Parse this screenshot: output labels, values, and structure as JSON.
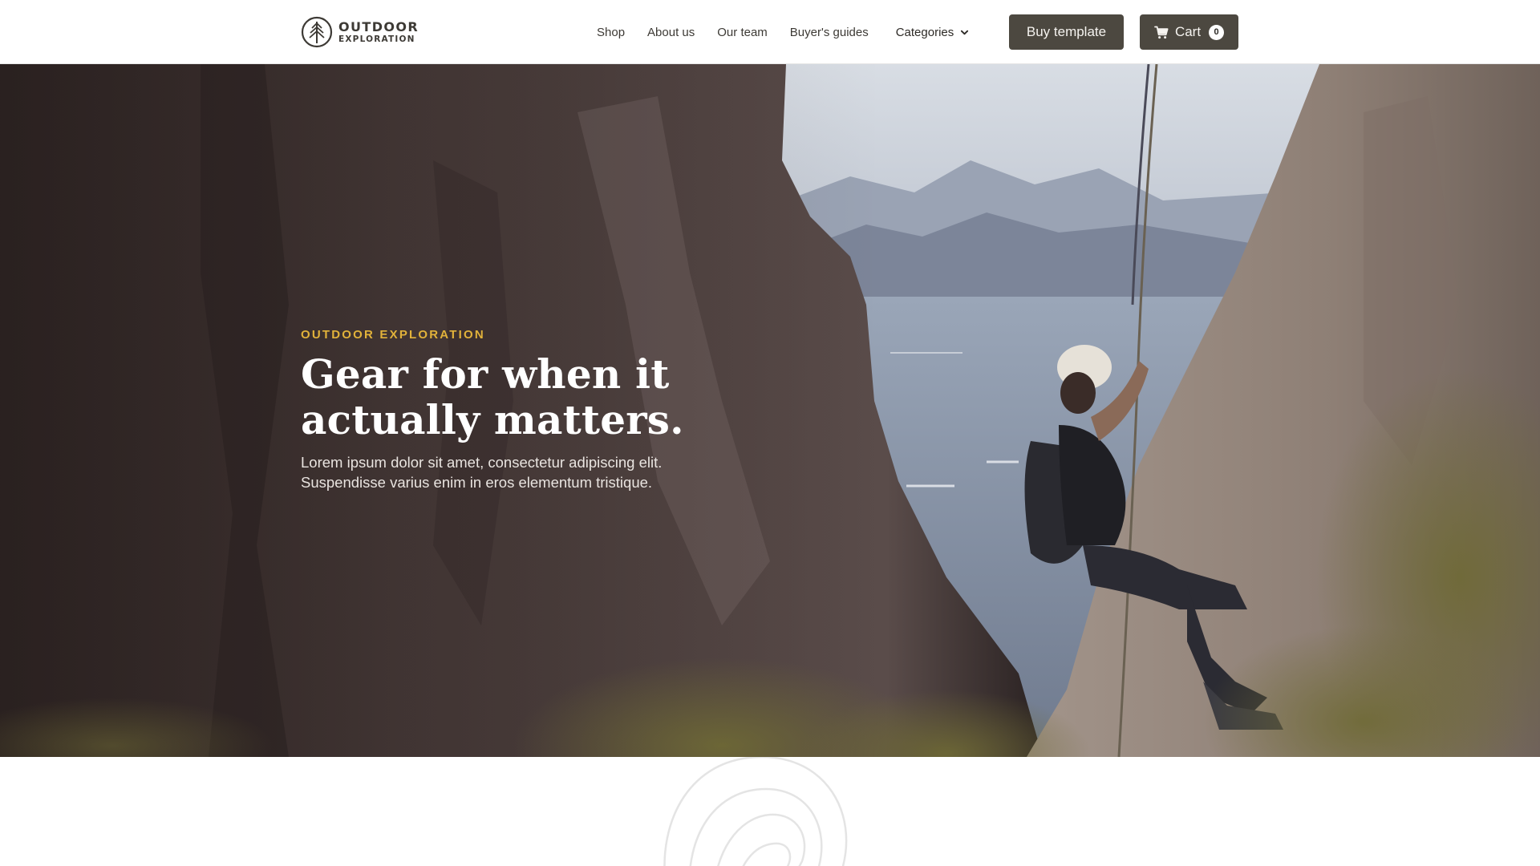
{
  "nav": {
    "logo": {
      "line1": "OUTDOOR",
      "line2": "EXPLORATION",
      "icon": "tree-logo-icon"
    },
    "links": [
      {
        "label": "Shop"
      },
      {
        "label": "About us"
      },
      {
        "label": "Our team"
      },
      {
        "label": "Buyer's guides"
      }
    ],
    "dropdown": {
      "label": "Categories",
      "icon": "chevron-down-icon"
    },
    "buy_button": {
      "label": "Buy template"
    },
    "cart": {
      "label": "Cart",
      "count": "0",
      "icon": "cart-icon"
    }
  },
  "hero": {
    "eyebrow": "OUTDOOR EXPLORATION",
    "title_line1": "Gear for when it",
    "title_line2": "actually matters.",
    "description_line1": "Lorem ipsum dolor sit amet, consectetur adipiscing elit.",
    "description_line2": "Suspendisse varius enim in eros elementum tristique."
  },
  "colors": {
    "accent": "#e1b23a",
    "button_bg": "#4c4840",
    "nav_text": "#3d3a35"
  }
}
